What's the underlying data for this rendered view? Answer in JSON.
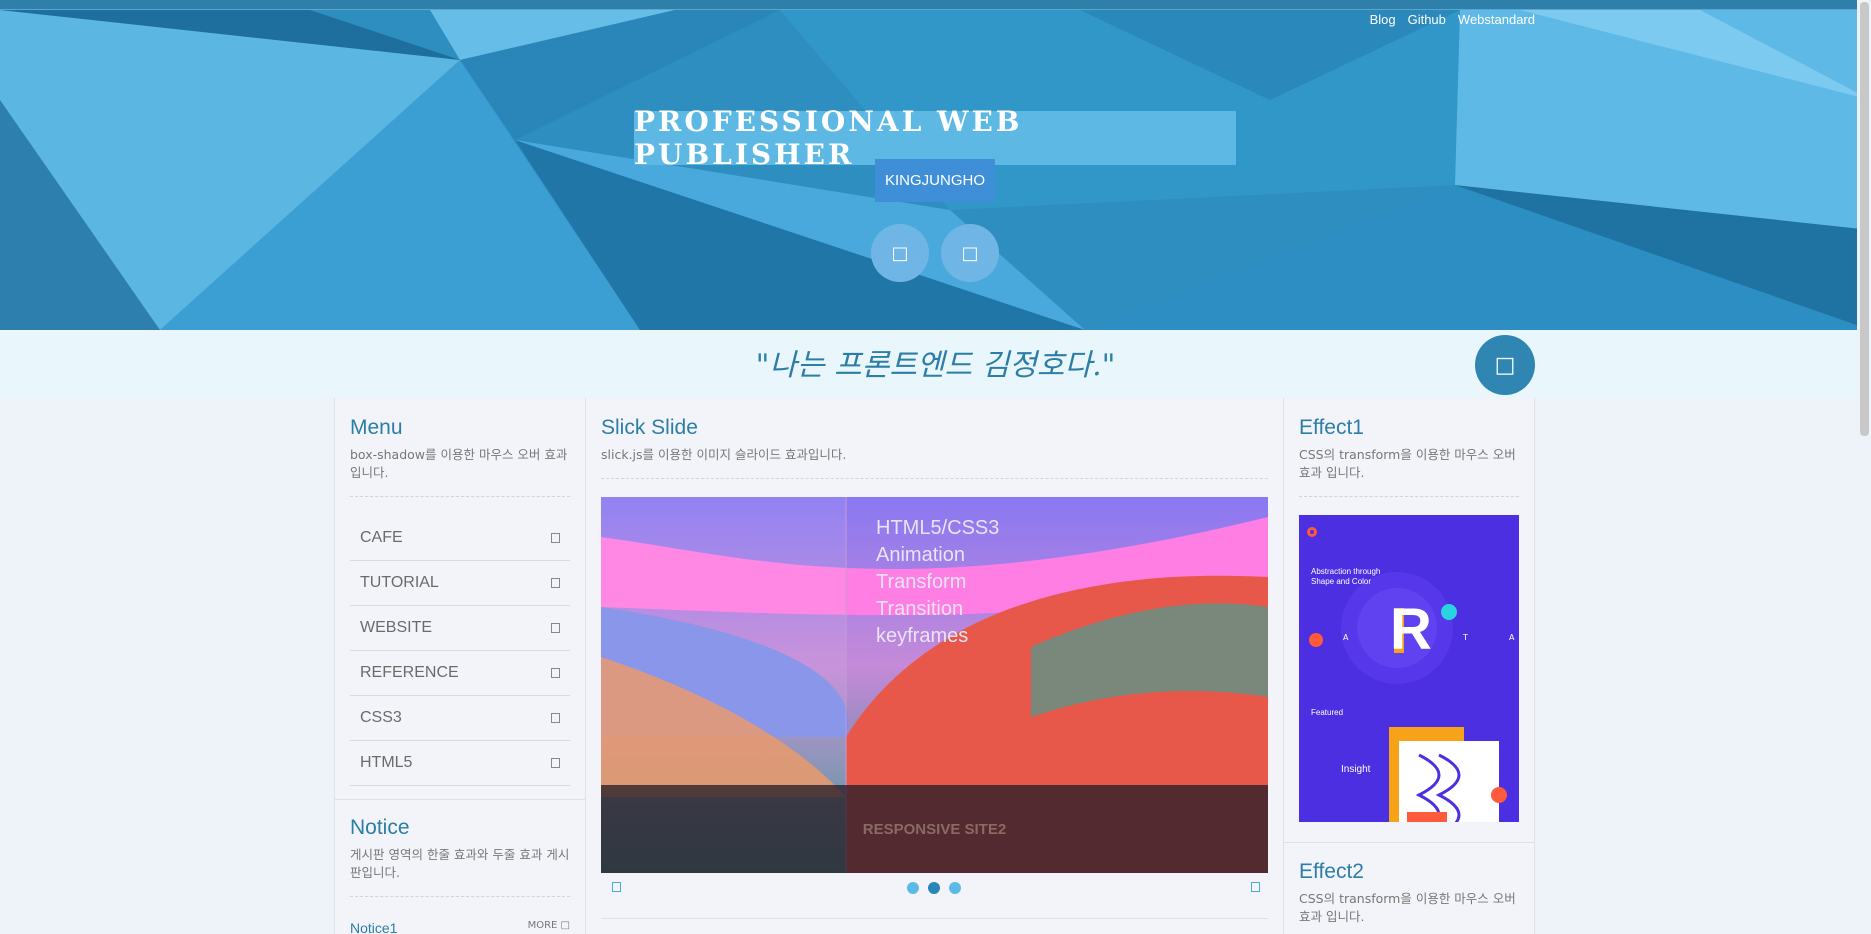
{
  "topnav": {
    "blog": "Blog",
    "github": "Github",
    "webstandard": "Webstandard"
  },
  "hero": {
    "title": "PROFESSIONAL WEB PUBLISHER",
    "subtitle": "KINGJUNGHO",
    "btn1_icon": "□",
    "btn2_icon": "□"
  },
  "slogan": {
    "text": "\"나는 프론트엔드 김정호다.\"",
    "fab_icon": "□"
  },
  "menu": {
    "title": "Menu",
    "desc": "box-shadow를 이용한 마우스 오버 효과입니다.",
    "items": [
      {
        "label": "CAFE"
      },
      {
        "label": "TUTORIAL"
      },
      {
        "label": "WEBSITE"
      },
      {
        "label": "REFERENCE"
      },
      {
        "label": "CSS3"
      },
      {
        "label": "HTML5"
      }
    ]
  },
  "notice": {
    "title": "Notice",
    "desc": "게시판 영역의 한줄 효과와 두줄 효과 게시판입니다.",
    "first_item": "Notice1",
    "more": "MORE □"
  },
  "slick": {
    "title": "Slick Slide",
    "desc": "slick.js를 이용한 이미지 슬라이드 효과입니다.",
    "slide_lines": [
      "HTML5/CSS3",
      "Animation",
      "Transform",
      "Transition",
      "keyframes"
    ],
    "caption": "RESPONSIVE SITE2",
    "active_dot": 1,
    "dot_count": 3
  },
  "effect1": {
    "title": "Effect1",
    "desc": "CSS의 transform을 이용한 마우스 오버 효과 입니다.",
    "image_headline": "Abstraction through Shape and Color",
    "image_featured": "Featured",
    "image_insight": "Insight",
    "image_letter": "R",
    "image_side_letters": [
      "A",
      "T",
      "A"
    ]
  },
  "effect2": {
    "title": "Effect2",
    "desc": "CSS의 transform을 이용한 마우스 오버 효과 입니다."
  },
  "colors": {
    "accent": "#2c7ea6",
    "hero_bg": "#2f8ec0",
    "title_box": "#5db8e4",
    "sub_box": "#3f8fd8"
  }
}
